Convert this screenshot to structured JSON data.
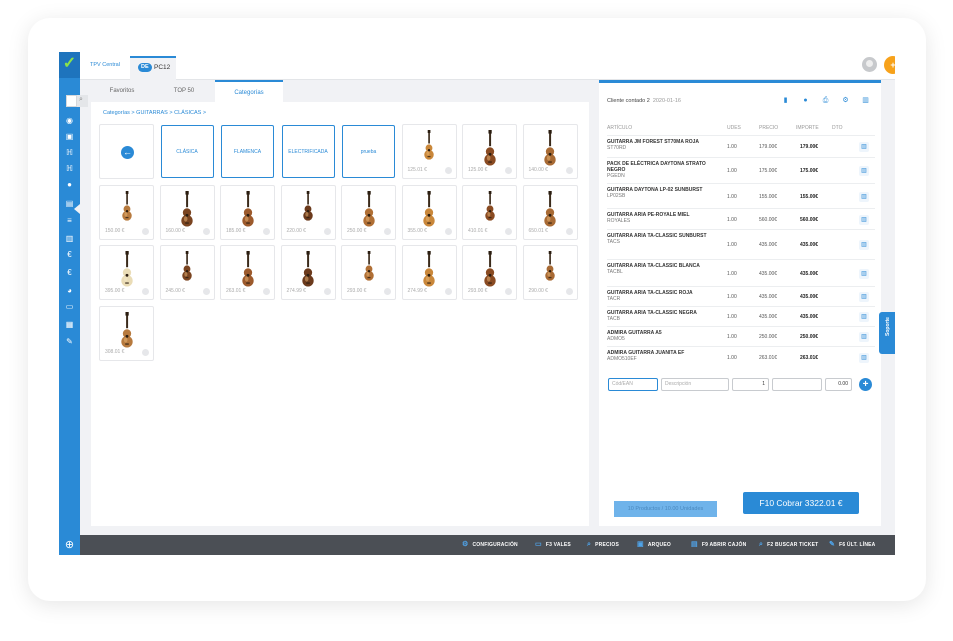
{
  "topbar": {
    "terminal_label": "TPV Central",
    "badge": "DE",
    "pc_label": "PC12"
  },
  "tabs": [
    {
      "label": "Favoritos"
    },
    {
      "label": "TOP 50"
    },
    {
      "label": "Categorías"
    }
  ],
  "breadcrumb": "Categorías > GUITARRAS > CLÁSICAS >",
  "categories": [
    "CLÁSICA",
    "FLAMENCA",
    "ELECTRIFICADA",
    "prueba"
  ],
  "products": [
    {
      "price": "125.01 €"
    },
    {
      "price": "125.00 €"
    },
    {
      "price": "140.00 €"
    },
    {
      "price": "150.00 €"
    },
    {
      "price": "160.00 €"
    },
    {
      "price": "185.00 €"
    },
    {
      "price": "220.00 €"
    },
    {
      "price": "250.00 €"
    },
    {
      "price": "355.00 €"
    },
    {
      "price": "410.01 €"
    },
    {
      "price": "650.01 €"
    },
    {
      "price": "395.00 €"
    },
    {
      "price": "245.00 €"
    },
    {
      "price": "263.01 €"
    },
    {
      "price": "274.99 €"
    },
    {
      "price": "293.00 €"
    },
    {
      "price": "274.99 €"
    },
    {
      "price": "293.00 €"
    },
    {
      "price": "290.00 €"
    },
    {
      "price": "308.01 €"
    }
  ],
  "ticket": {
    "client": "Cliente contado 2",
    "date": "2020-01-16",
    "headers": {
      "article": "ARTÍCULO",
      "units": "UDES",
      "price": "PRECIO",
      "amount": "IMPORTE",
      "discount": "DTO"
    },
    "lines": [
      {
        "name": "GUITARRA JM FOREST ST70MA ROJA",
        "code": "ST70RD",
        "units": "1.00",
        "price": "179.00€",
        "amount": "179.00€"
      },
      {
        "name": "PACK DE ELÉCTRICA DAYTONA STRATO NEGRO",
        "code": "PGEDN",
        "units": "1.00",
        "price": "175.00€",
        "amount": "175.00€"
      },
      {
        "name": "GUITARRA DAYTONA LP-02 SUNBURST",
        "code": "LP02SB",
        "units": "1.00",
        "price": "155.00€",
        "amount": "155.00€"
      },
      {
        "name": "GUITARRA ARIA PE-ROYALE MIEL",
        "code": "ROYALES",
        "units": "1.00",
        "price": "560.00€",
        "amount": "560.00€"
      },
      {
        "name": "GUITARRA ARIA TA-CLASSIC SUNBURST",
        "code": "TACS",
        "units": "1.00",
        "price": "435.00€",
        "amount": "435.00€"
      },
      {
        "name": "GUITARRA ARIA TA-CLASSIC BLANCA",
        "code": "TACBL",
        "units": "1.00",
        "price": "435.00€",
        "amount": "435.00€"
      },
      {
        "name": "GUITARRA ARIA TA-CLASSIC ROJA",
        "code": "TACR",
        "units": "1.00",
        "price": "435.00€",
        "amount": "435.00€"
      },
      {
        "name": "GUITARRA ARIA TA-CLASSIC NEGRA",
        "code": "TACB",
        "units": "1.00",
        "price": "435.00€",
        "amount": "435.00€"
      },
      {
        "name": "ADMIRA GUITARRA A5",
        "code": "ADMO5",
        "units": "1.00",
        "price": "250.00€",
        "amount": "250.00€"
      },
      {
        "name": "ADMIRA GUITARRA JUANITA EF",
        "code": "ADMO510EF",
        "units": "1.00",
        "price": "263.01€",
        "amount": "263.01€"
      }
    ],
    "entry": {
      "ean_placeholder": "Cód/EAN",
      "desc_placeholder": "Descripción",
      "qty": "1",
      "discount": "0.00"
    },
    "summary": "10 Productos / 10.00 Unidades",
    "pay_label": "F10 Cobrar 3322.01 €"
  },
  "support_label": "Soporte",
  "bottombar": [
    {
      "label": "CONFIGURACIÓN",
      "icon": "gear-icon"
    },
    {
      "label": "F3 VALES",
      "icon": "ticket-icon"
    },
    {
      "label": "PRECIOS",
      "icon": "search-icon"
    },
    {
      "label": "ARQUEO",
      "icon": "cash-icon"
    },
    {
      "label": "F9 ABRIR CAJÓN",
      "icon": "drawer-icon"
    },
    {
      "label": "F2 BUSCAR TICKET",
      "icon": "search-icon"
    },
    {
      "label": "F6 ÚLT. LÍNEA",
      "icon": "edit-icon"
    }
  ],
  "colors": {
    "accent": "#2a8ad6",
    "orange": "#f7a21b",
    "green": "#8be34a",
    "bar": "#4b4f55"
  }
}
